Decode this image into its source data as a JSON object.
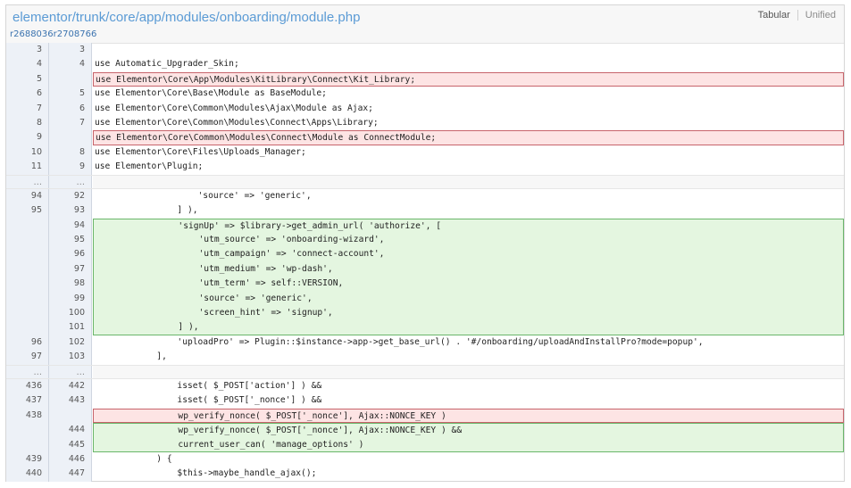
{
  "header": {
    "file_path": "elementor/trunk/core/app/modules/onboarding/module.php",
    "view_tabular": "Tabular",
    "view_unified": "Unified"
  },
  "revisions": {
    "old_rev": "r2688036",
    "new_rev": "r2708766"
  },
  "rows": [
    {
      "type": "context",
      "old": "3",
      "new": "3",
      "code": ""
    },
    {
      "type": "context",
      "old": "4",
      "new": "4",
      "code": "use Automatic_Upgrader_Skin;"
    },
    {
      "type": "removed",
      "old": "5",
      "new": "",
      "code": "use Elementor\\Core\\App\\Modules\\KitLibrary\\Connect\\Kit_Library;"
    },
    {
      "type": "context",
      "old": "6",
      "new": "5",
      "code": "use Elementor\\Core\\Base\\Module as BaseModule;"
    },
    {
      "type": "context",
      "old": "7",
      "new": "6",
      "code": "use Elementor\\Core\\Common\\Modules\\Ajax\\Module as Ajax;"
    },
    {
      "type": "context",
      "old": "8",
      "new": "7",
      "code": "use Elementor\\Core\\Common\\Modules\\Connect\\Apps\\Library;"
    },
    {
      "type": "removed",
      "old": "9",
      "new": "",
      "code": "use Elementor\\Core\\Common\\Modules\\Connect\\Module as ConnectModule;"
    },
    {
      "type": "context",
      "old": "10",
      "new": "8",
      "code": "use Elementor\\Core\\Files\\Uploads_Manager;"
    },
    {
      "type": "context",
      "old": "11",
      "new": "9",
      "code": "use Elementor\\Plugin;"
    },
    {
      "type": "skip",
      "old": "…",
      "new": "…",
      "code": ""
    },
    {
      "type": "context",
      "old": "94",
      "new": "92",
      "code": "                    'source' => 'generic',"
    },
    {
      "type": "context",
      "old": "95",
      "new": "93",
      "code": "                ] ),"
    },
    {
      "type": "added",
      "pos": "first",
      "old": "",
      "new": "94",
      "code": "                'signUp' => $library->get_admin_url( 'authorize', ["
    },
    {
      "type": "added",
      "old": "",
      "new": "95",
      "code": "                    'utm_source' => 'onboarding-wizard',"
    },
    {
      "type": "added",
      "old": "",
      "new": "96",
      "code": "                    'utm_campaign' => 'connect-account',"
    },
    {
      "type": "added",
      "old": "",
      "new": "97",
      "code": "                    'utm_medium' => 'wp-dash',"
    },
    {
      "type": "added",
      "old": "",
      "new": "98",
      "code": "                    'utm_term' => self::VERSION,"
    },
    {
      "type": "added",
      "old": "",
      "new": "99",
      "code": "                    'source' => 'generic',"
    },
    {
      "type": "added",
      "old": "",
      "new": "100",
      "code": "                    'screen_hint' => 'signup',"
    },
    {
      "type": "added",
      "pos": "last",
      "old": "",
      "new": "101",
      "code": "                ] ),"
    },
    {
      "type": "context",
      "old": "96",
      "new": "102",
      "code": "                'uploadPro' => Plugin::$instance->app->get_base_url() . '#/onboarding/uploadAndInstallPro?mode=popup',"
    },
    {
      "type": "context",
      "old": "97",
      "new": "103",
      "code": "            ],"
    },
    {
      "type": "skip",
      "old": "…",
      "new": "…",
      "code": ""
    },
    {
      "type": "context",
      "old": "436",
      "new": "442",
      "code": "                isset( $_POST['action'] ) &&"
    },
    {
      "type": "context",
      "old": "437",
      "new": "443",
      "code": "                isset( $_POST['_nonce'] ) &&"
    },
    {
      "type": "removed",
      "old": "438",
      "new": "",
      "code": "                wp_verify_nonce( $_POST['_nonce'], Ajax::NONCE_KEY )"
    },
    {
      "type": "added",
      "pos": "first",
      "old": "",
      "new": "444",
      "code": "                wp_verify_nonce( $_POST['_nonce'], Ajax::NONCE_KEY ) &&"
    },
    {
      "type": "added",
      "pos": "last",
      "old": "",
      "new": "445",
      "code": "                current_user_can( 'manage_options' )"
    },
    {
      "type": "context",
      "old": "439",
      "new": "446",
      "code": "            ) {"
    },
    {
      "type": "context",
      "old": "440",
      "new": "447",
      "code": "                $this->maybe_handle_ajax();"
    }
  ]
}
